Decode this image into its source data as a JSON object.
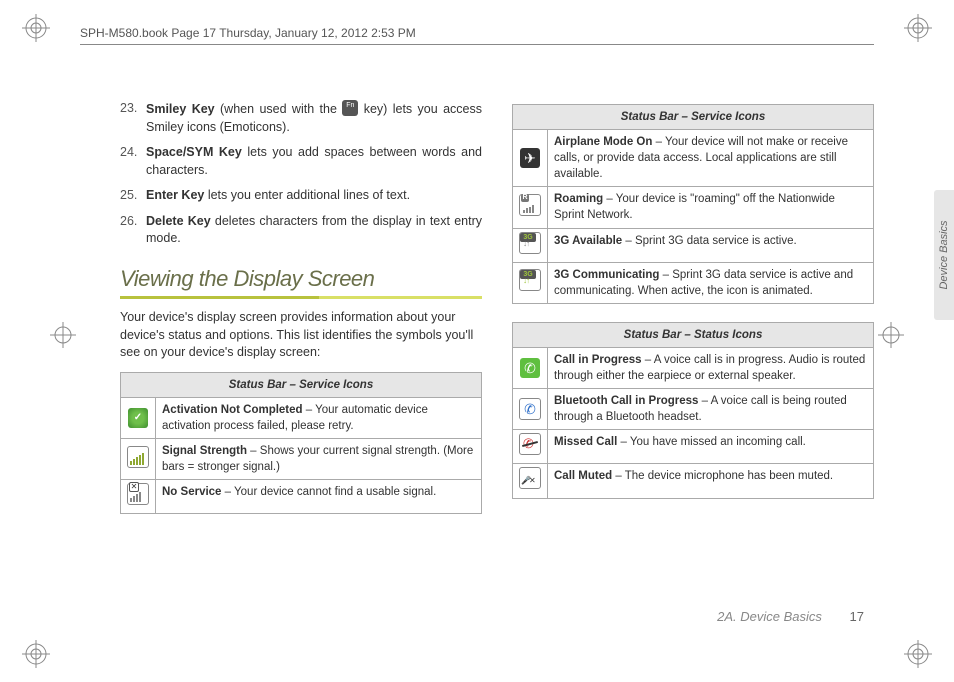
{
  "header": "SPH-M580.book  Page 17  Thursday, January 12, 2012  2:53 PM",
  "sideTab": "Device Basics",
  "footer": {
    "section": "2A. Device Basics",
    "page": "17"
  },
  "list": {
    "i23": {
      "num": "23.",
      "bold": "Smiley Key",
      "rest1": " (when used with the ",
      "rest2": " key) lets you access Smiley icons (Emoticons)."
    },
    "i24": {
      "num": "24.",
      "bold": "Space/SYM Key",
      "rest": " lets you add spaces between words and characters."
    },
    "i25": {
      "num": "25.",
      "bold": "Enter Key",
      "rest": " lets you enter additional lines of text."
    },
    "i26": {
      "num": "26.",
      "bold": "Delete Key",
      "rest": " deletes characters from the display in text entry mode."
    }
  },
  "sectionTitle": "Viewing the Display Screen",
  "intro": "Your device's display screen provides information about your device's status and options. This list identifies the symbols you'll see on your device's display screen:",
  "tables": {
    "service1": {
      "header": "Status Bar – Service Icons",
      "rows": {
        "activation": {
          "bold": "Activation Not Completed",
          "rest": " – Your automatic device activation process failed, please retry."
        },
        "signal": {
          "bold": "Signal Strength",
          "rest": " – Shows your current signal strength. (More bars = stronger signal.)"
        },
        "noservice": {
          "bold": "No Service",
          "rest": " – Your device cannot find a usable signal."
        }
      }
    },
    "service2": {
      "header": "Status Bar – Service Icons",
      "rows": {
        "airplane": {
          "bold": "Airplane Mode On",
          "rest": " – Your device will not make or receive calls, or provide data access. Local applications are still available."
        },
        "roaming": {
          "bold": "Roaming",
          "rest": " – Your device is \"roaming\" off the Nationwide Sprint Network."
        },
        "g3": {
          "bold": "3G Available",
          "rest": " – Sprint 3G data service is active."
        },
        "g3comm": {
          "bold": "3G Communicating",
          "rest": " – Sprint 3G data service is active and communicating. When active, the icon is animated."
        }
      }
    },
    "status": {
      "header": "Status Bar – Status Icons",
      "rows": {
        "call": {
          "bold": "Call in Progress",
          "rest": " – A voice call is in progress. Audio is routed through either the earpiece or external speaker."
        },
        "btcall": {
          "bold": "Bluetooth Call in Progress",
          "rest": " – A voice call is being routed through a Bluetooth headset."
        },
        "missed": {
          "bold": "Missed Call",
          "rest": " – You have missed an incoming call."
        },
        "muted": {
          "bold": "Call Muted",
          "rest": " – The device microphone has been muted."
        }
      }
    }
  }
}
